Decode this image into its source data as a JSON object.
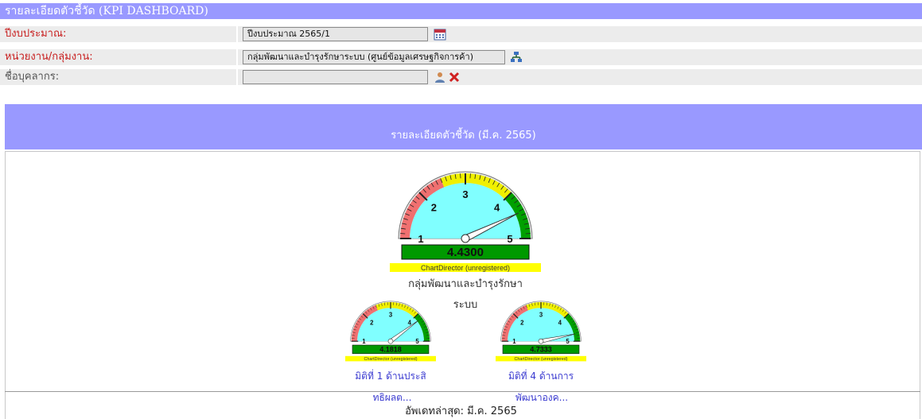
{
  "header": {
    "title": "รายละเอียดตัวชี้วัด  (KPI DASHBOARD)"
  },
  "form": {
    "budget_label": "ปีงบประมาณ:",
    "budget_value": "ปีงบประมาณ 2565/1",
    "unit_label": "หน่วยงาน/กลุ่มงาน:",
    "unit_value": "กลุ่มพัฒนาและบำรุงรักษาระบบ (ศูนย์ข้อมูลเศรษฐกิจการค้า)",
    "person_label": "ชื่อบุคลากร:",
    "person_value": ""
  },
  "section": {
    "title": "รายละเอียดตัวชี้วัด (มี.ค. 2565)"
  },
  "gauges": {
    "main": {
      "value": "4.4300",
      "score": 4.43,
      "watermark": "ChartDirector (unregistered)",
      "title_line1": "กลุ่มพัฒนาและบำรุงรักษา",
      "title_line2": "ระบบ"
    },
    "left": {
      "value": "4.1818",
      "score": 4.1818,
      "watermark": "ChartDirector (unregistered)",
      "title_line1": "มิติที่ 1 ด้านประสิ",
      "title_line2": "ทธิผลต..."
    },
    "right": {
      "value": "4.7333",
      "score": 4.7333,
      "watermark": "ChartDirector (unregistered)",
      "title_line1": "มิติที่ 4 ด้านการ",
      "title_line2": "พัฒนาองค..."
    }
  },
  "scale": {
    "min": 1,
    "max": 5,
    "ticks": [
      "1",
      "2",
      "3",
      "4",
      "5"
    ]
  },
  "colors": {
    "header": "#9999ff",
    "red_zone": "#f07070",
    "yellow_zone": "#f0f000",
    "green_zone": "#00a000",
    "inner_zone": "#80ffff",
    "value_box": "#009900",
    "watermark": "#ffff00"
  },
  "footer": {
    "updated": "อัพเดทล่าสุด: มี.ค. 2565"
  }
}
